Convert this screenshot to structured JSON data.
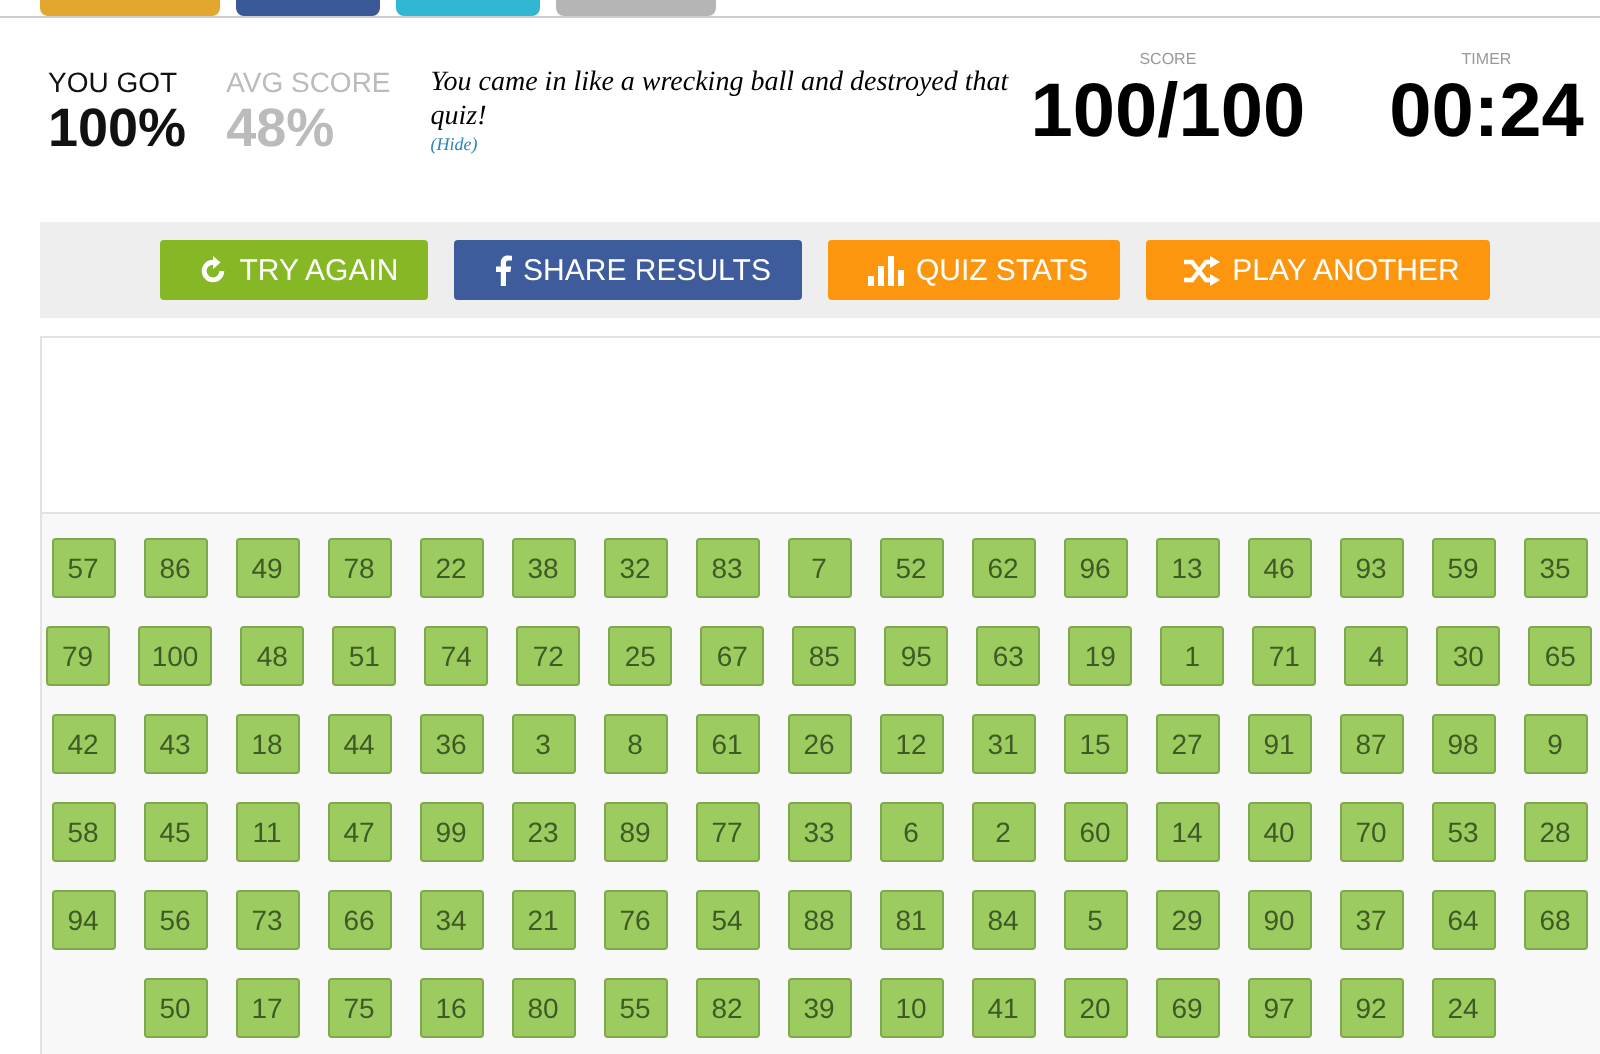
{
  "results": {
    "you_got_label": "YOU GOT",
    "you_got": "100%",
    "avg_label": "AVG SCORE",
    "avg": "48%",
    "message": "You came in like a wrecking ball and destroyed that quiz!",
    "hide_link": "(Hide)",
    "score_label": "SCORE",
    "score": "100/100",
    "timer_label": "TIMER",
    "timer": "00:24"
  },
  "buttons": [
    {
      "label": "TRY AGAIN",
      "kind": "retry"
    },
    {
      "label": "SHARE RESULTS",
      "kind": "share"
    },
    {
      "label": "QUIZ STATS",
      "kind": "stats"
    },
    {
      "label": "PLAY ANOTHER",
      "kind": "shuffle"
    }
  ],
  "answer_rows": [
    [
      "57",
      "86",
      "49",
      "78",
      "22",
      "38",
      "32",
      "83",
      "7",
      "52",
      "62",
      "96",
      "13",
      "46",
      "93",
      "59",
      "35"
    ],
    [
      "79",
      "100",
      "48",
      "51",
      "74",
      "72",
      "25",
      "67",
      "85",
      "95",
      "63",
      "19",
      "1",
      "71",
      "4",
      "30",
      "65"
    ],
    [
      "42",
      "43",
      "18",
      "44",
      "36",
      "3",
      "8",
      "61",
      "26",
      "12",
      "31",
      "15",
      "27",
      "91",
      "87",
      "98",
      "9"
    ],
    [
      "58",
      "45",
      "11",
      "47",
      "99",
      "23",
      "89",
      "77",
      "33",
      "6",
      "2",
      "60",
      "14",
      "40",
      "70",
      "53",
      "28"
    ],
    [
      "94",
      "56",
      "73",
      "66",
      "34",
      "21",
      "76",
      "54",
      "88",
      "81",
      "84",
      "5",
      "29",
      "90",
      "37",
      "64",
      "68"
    ],
    [
      "50",
      "17",
      "75",
      "16",
      "80",
      "55",
      "82",
      "39",
      "10",
      "41",
      "20",
      "69",
      "97",
      "92",
      "24"
    ]
  ]
}
